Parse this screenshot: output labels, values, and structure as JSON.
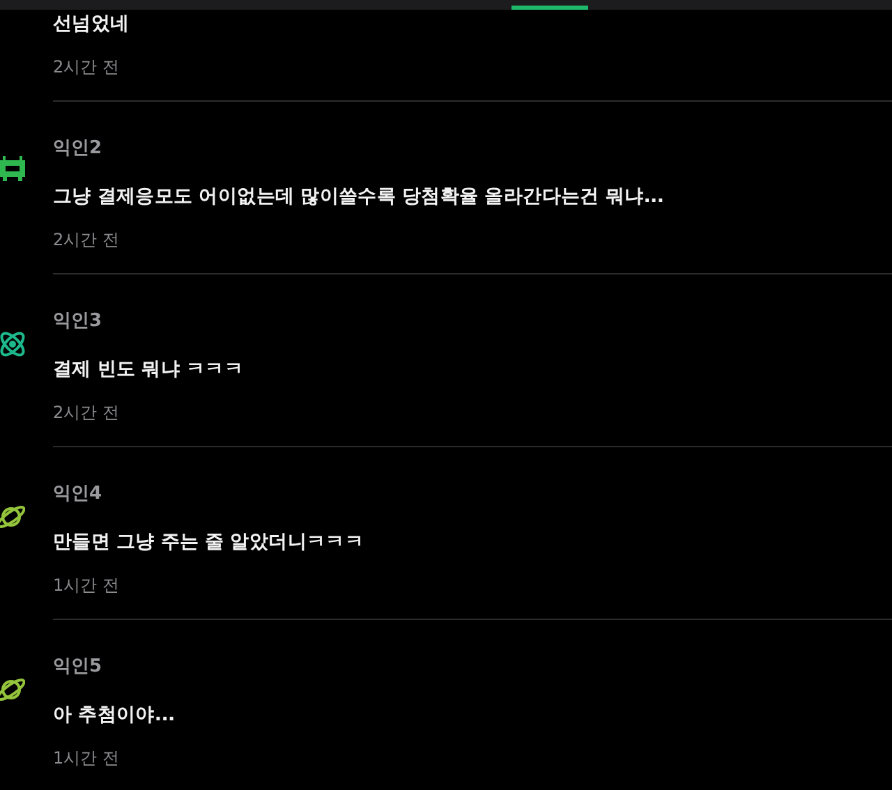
{
  "tab_bar": {
    "tabs": [
      {
        "selected": true
      }
    ]
  },
  "comments": [
    {
      "body": "선넘었네",
      "time": "2시간 전"
    },
    {
      "author": "익인2",
      "kind": "invader",
      "color": "#2fb84f",
      "body": "그냥 결제응모도 어이없는데 많이쓸수록 당첨확율 올라간다는건 뭐냐...",
      "time": "2시간 전"
    },
    {
      "author": "익인3",
      "kind": "atom",
      "color": "#1db88c",
      "body": "결제 빈도 뭐냐 ㅋㅋㅋ",
      "time": "2시간 전"
    },
    {
      "author": "익인4",
      "kind": "planet",
      "color": "#93c43c",
      "body": "만들면 그냥 주는 줄 알았더니ㅋㅋㅋ",
      "time": "1시간 전"
    },
    {
      "author": "익인5",
      "kind": "planet",
      "color": "#93c43c",
      "body": "아 추첨이야...",
      "time": "1시간 전"
    }
  ]
}
